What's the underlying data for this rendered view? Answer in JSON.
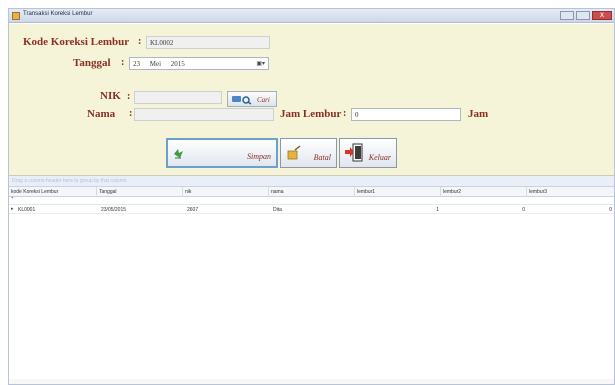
{
  "window": {
    "title": "Transaksi Koreksi Lembur"
  },
  "form": {
    "kode": {
      "label": "Kode Koreksi Lembur",
      "colon": ":",
      "value": "KL0002"
    },
    "tanggal": {
      "label": "Tanggal",
      "colon": ":",
      "day": "23",
      "month": "Mei",
      "year": "2015"
    },
    "nik": {
      "label": "NIK",
      "colon": ":",
      "value": ""
    },
    "nama": {
      "label": "Nama",
      "colon": ":",
      "value": ""
    },
    "cari_button": "Cari",
    "jam_lembur": {
      "label": "Jam Lembur",
      "colon": ":",
      "value": "0",
      "unit": "Jam"
    }
  },
  "actions": {
    "simpan": "Simpan",
    "batal": "Batal",
    "keluar": "Keluar"
  },
  "grid": {
    "group_hint": "Drag a column header here to group by that column",
    "columns": [
      "kode Koreksi Lembur",
      "Tanggal",
      "nik",
      "nama",
      "lembur1",
      "lembur2",
      "lembur3"
    ],
    "rows": [
      {
        "kode": "KL0001",
        "tanggal": "23/05/2015",
        "nik": "2607",
        "nama": "Dita",
        "lembur1": "1",
        "lembur2": "0",
        "lembur3": "0"
      }
    ],
    "footer": "..."
  },
  "colors": {
    "form_bg": "#f5f3d8",
    "label": "#8a2f24",
    "selected_border": "#6aa2ce"
  },
  "icons": {
    "cari": "search-icon",
    "simpan": "save-icon",
    "batal": "cancel-icon",
    "keluar": "exit-icon"
  }
}
